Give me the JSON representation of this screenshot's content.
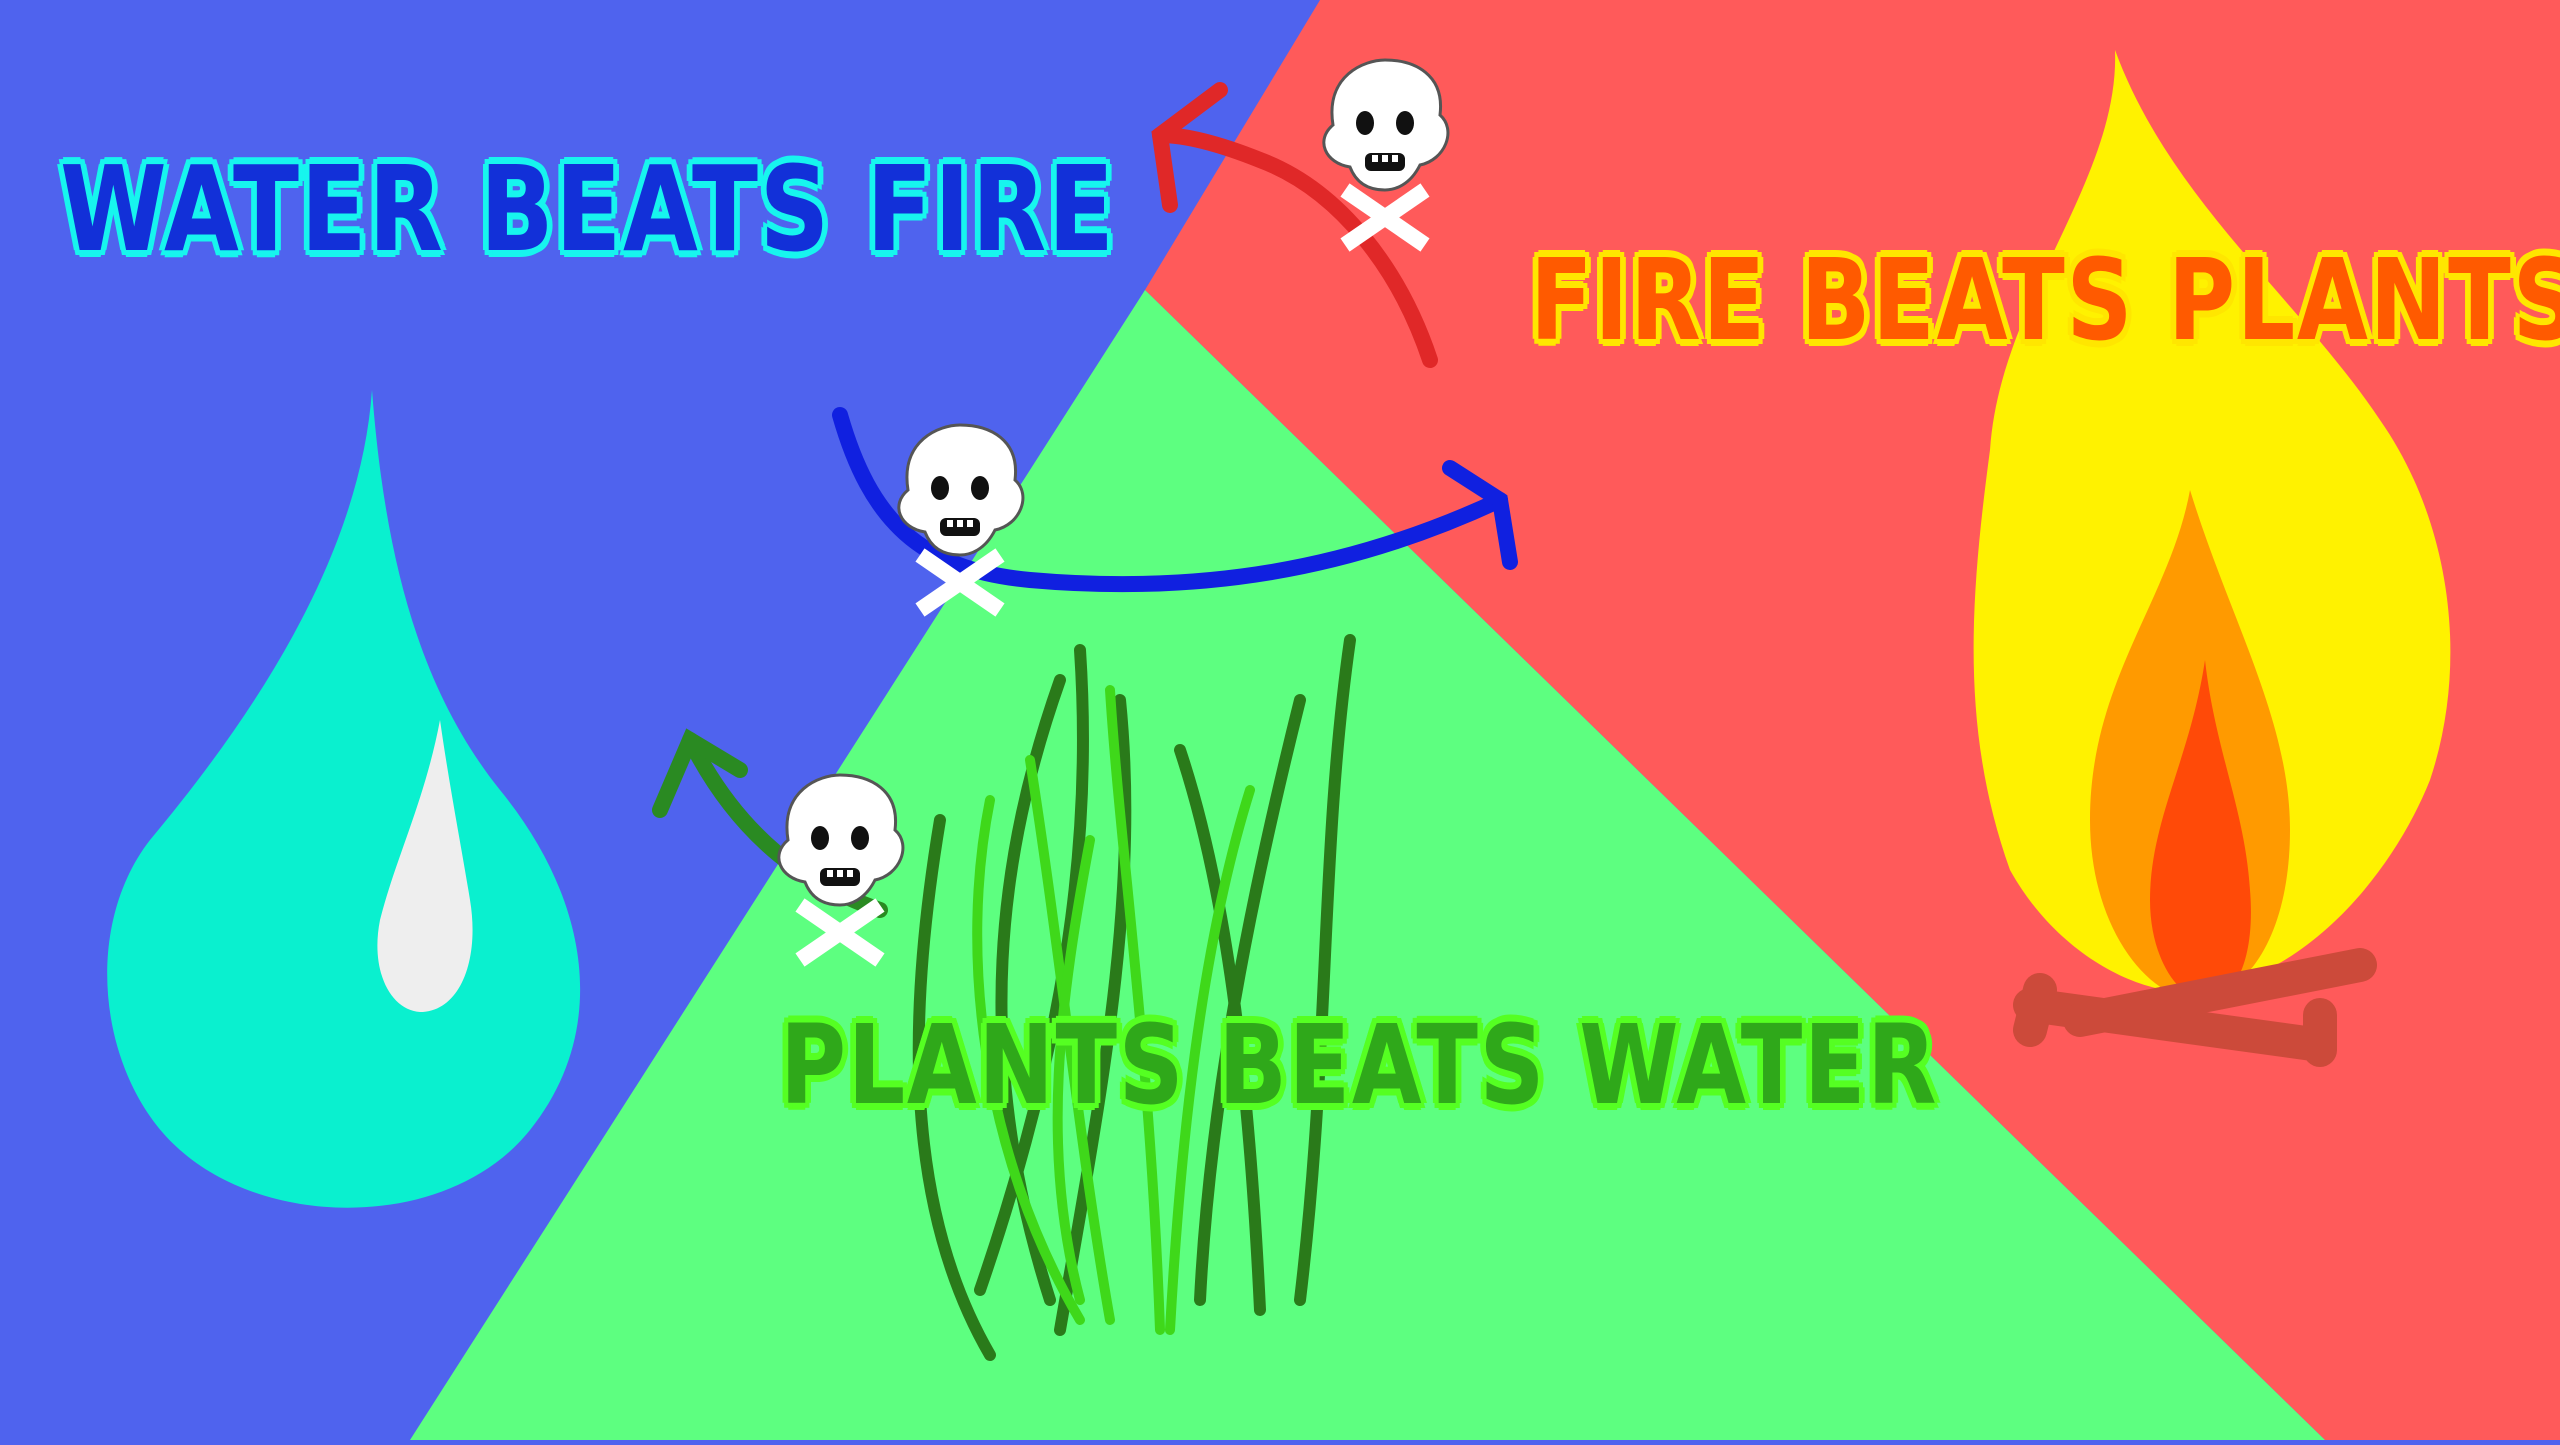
{
  "labels": {
    "water_beats_fire": "WATER BEATS FIRE",
    "fire_beats_plants": "FIRE BEATS PLANTS",
    "plants_beats_water": "PLANTS BEATS WATER"
  },
  "colors": {
    "water_region": "#4f63ee",
    "fire_region": "#ff5a5a",
    "plants_region": "#5dff80",
    "water_arrow": "#1020e0",
    "fire_arrow": "#e02828",
    "plants_arrow": "#2a8a22",
    "droplet": "#0af0cf",
    "flame_outer": "#fff200",
    "flame_middle": "#ff9a00",
    "flame_inner": "#ff4a08",
    "logs": "#cc4a3a"
  },
  "icons": [
    "water-droplet-icon",
    "campfire-icon",
    "grass-icon",
    "skull-crossbones-icon"
  ]
}
